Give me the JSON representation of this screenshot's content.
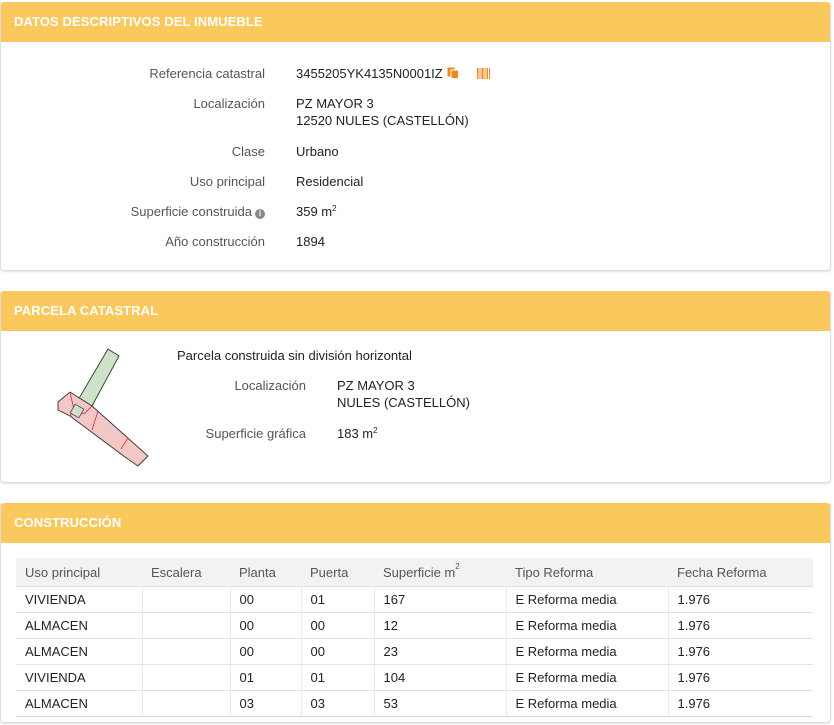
{
  "colors": {
    "header_bg": "#fbc85e",
    "header_text": "#ffffff",
    "icon_orange": "#ee8a1e",
    "plot_red": "#f4c7c7",
    "plot_green": "#cde2c9"
  },
  "datos": {
    "title": "DATOS DESCRIPTIVOS DEL INMUEBLE",
    "ref_label": "Referencia catastral",
    "ref_value": "3455205YK4135N0001IZ",
    "loc_label": "Localización",
    "loc_line1": "PZ MAYOR 3",
    "loc_line2": "12520 NULES (CASTELLÓN)",
    "clase_label": "Clase",
    "clase_value": "Urbano",
    "uso_label": "Uso principal",
    "uso_value": "Residencial",
    "sup_label": "Superficie construida",
    "sup_value": "359 m",
    "sup_exp": "2",
    "anio_label": "Año construcción",
    "anio_value": "1894",
    "icons": [
      "copy-icon",
      "barcode-icon",
      "info-icon"
    ]
  },
  "parcela": {
    "title": "PARCELA CATASTRAL",
    "desc": "Parcela construida sin división horizontal",
    "loc_label": "Localización",
    "loc_line1": "PZ MAYOR 3",
    "loc_line2": "NULES (CASTELLÓN)",
    "sup_label": "Superficie gráfica",
    "sup_value": "183 m",
    "sup_exp": "2"
  },
  "construccion": {
    "title": "CONSTRUCCIÓN",
    "headers": [
      "Uso principal",
      "Escalera",
      "Planta",
      "Puerta",
      "Superficie m",
      "Tipo Reforma",
      "Fecha Reforma"
    ],
    "sup_header_exp": "2",
    "rows": [
      [
        "VIVIENDA",
        "",
        "00",
        "01",
        "167",
        "E Reforma media",
        "1.976"
      ],
      [
        "ALMACEN",
        "",
        "00",
        "00",
        "12",
        "E Reforma media",
        "1.976"
      ],
      [
        "ALMACEN",
        "",
        "00",
        "00",
        "23",
        "E Reforma media",
        "1.976"
      ],
      [
        "VIVIENDA",
        "",
        "01",
        "01",
        "104",
        "E Reforma media",
        "1.976"
      ],
      [
        "ALMACEN",
        "",
        "03",
        "03",
        "53",
        "E Reforma media",
        "1.976"
      ]
    ]
  }
}
